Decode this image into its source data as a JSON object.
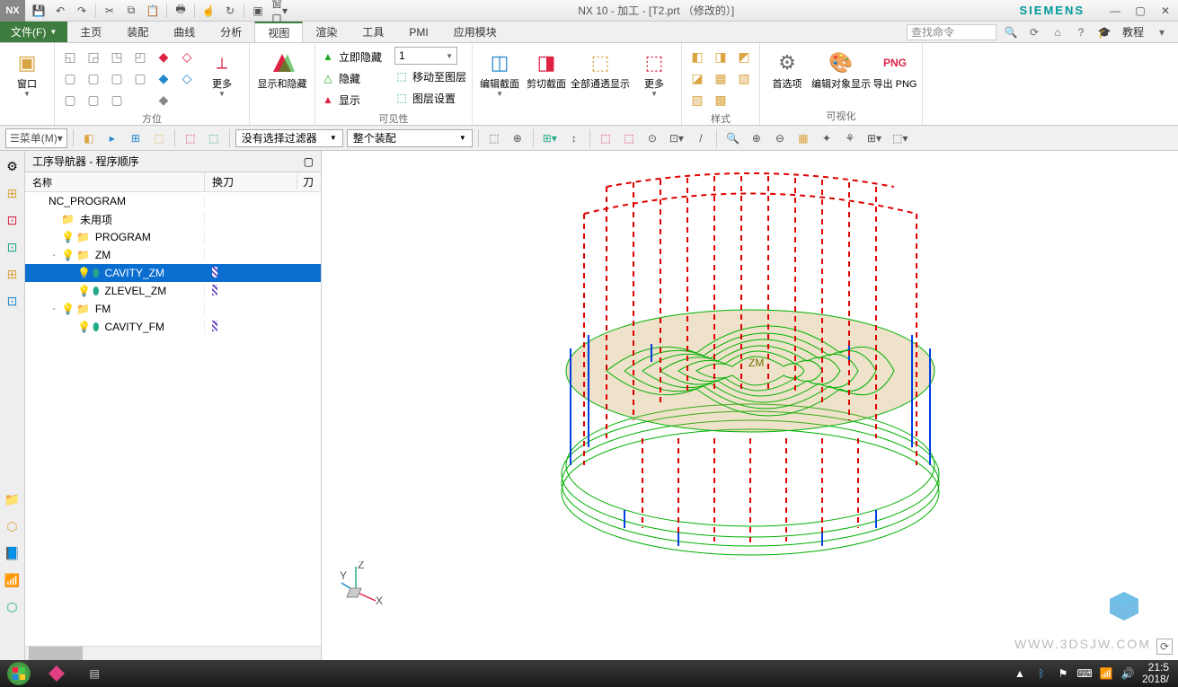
{
  "titlebar": {
    "app_title": "NX 10 - 加工 - [T2.prt （修改的）]",
    "brand": "SIEMENS",
    "qat": {
      "window_label": "窗口"
    }
  },
  "menu": {
    "file": "文件(F)",
    "tabs": [
      "主页",
      "装配",
      "曲线",
      "分析",
      "视图",
      "渲染",
      "工具",
      "PMI",
      "应用模块"
    ],
    "active_index": 4,
    "search_placeholder": "查找命令",
    "tutorial": "教程"
  },
  "ribbon": {
    "group_window": {
      "label": "",
      "window": "窗口"
    },
    "group_orient": {
      "label": "方位",
      "more": "更多"
    },
    "group_showhide": {
      "label": "",
      "btn": "显示和隐藏"
    },
    "group_visibility": {
      "label": "可见性",
      "items": [
        "立即隐藏",
        "隐藏",
        "显示"
      ],
      "move_layer": "移动至图层",
      "layer_settings": "图层设置",
      "layer_combo": "1"
    },
    "group_section": {
      "label": "",
      "edit": "编辑截面",
      "clip": "剪切截面",
      "seethrough": "全部通透显示",
      "more": "更多"
    },
    "group_style": {
      "label": "样式"
    },
    "group_visual": {
      "label": "可视化",
      "pref": "首选项",
      "objdisp": "编辑对象显示",
      "png": "导出 PNG",
      "png_badge": "PNG"
    }
  },
  "toolbar": {
    "menu": "菜单(M)",
    "filter": "没有选择过滤器",
    "scope": "整个装配"
  },
  "navigator": {
    "title": "工序导航器 - 程序顺序",
    "columns": [
      "名称",
      "换刀",
      "刀"
    ],
    "tree": [
      {
        "depth": 0,
        "exp": "",
        "icon": "",
        "label": "NC_PROGRAM",
        "tc": false,
        "sel": false
      },
      {
        "depth": 1,
        "exp": "",
        "icon": "folder",
        "label": "未用项",
        "tc": false,
        "sel": false
      },
      {
        "depth": 1,
        "exp": "",
        "icon": "bulb-folder",
        "label": "PROGRAM",
        "tc": false,
        "sel": false
      },
      {
        "depth": 1,
        "exp": "-",
        "icon": "bulb-folder",
        "label": "ZM",
        "tc": false,
        "sel": false
      },
      {
        "depth": 2,
        "exp": "",
        "icon": "bulb-op",
        "label": "CAVITY_ZM",
        "tc": true,
        "sel": true
      },
      {
        "depth": 2,
        "exp": "",
        "icon": "bulb-op",
        "label": "ZLEVEL_ZM",
        "tc": true,
        "sel": false
      },
      {
        "depth": 1,
        "exp": "-",
        "icon": "bulb-folder",
        "label": "FM",
        "tc": false,
        "sel": false
      },
      {
        "depth": 2,
        "exp": "",
        "icon": "bulb-op",
        "label": "CAVITY_FM",
        "tc": true,
        "sel": false
      }
    ]
  },
  "viewport": {
    "axis_labels": {
      "x": "X",
      "y": "Y",
      "z": "Z"
    },
    "center_label": "ZM",
    "watermark": "WWW.3DSJW.COM"
  },
  "taskbar": {
    "time": "21:5",
    "date": "2018/"
  }
}
